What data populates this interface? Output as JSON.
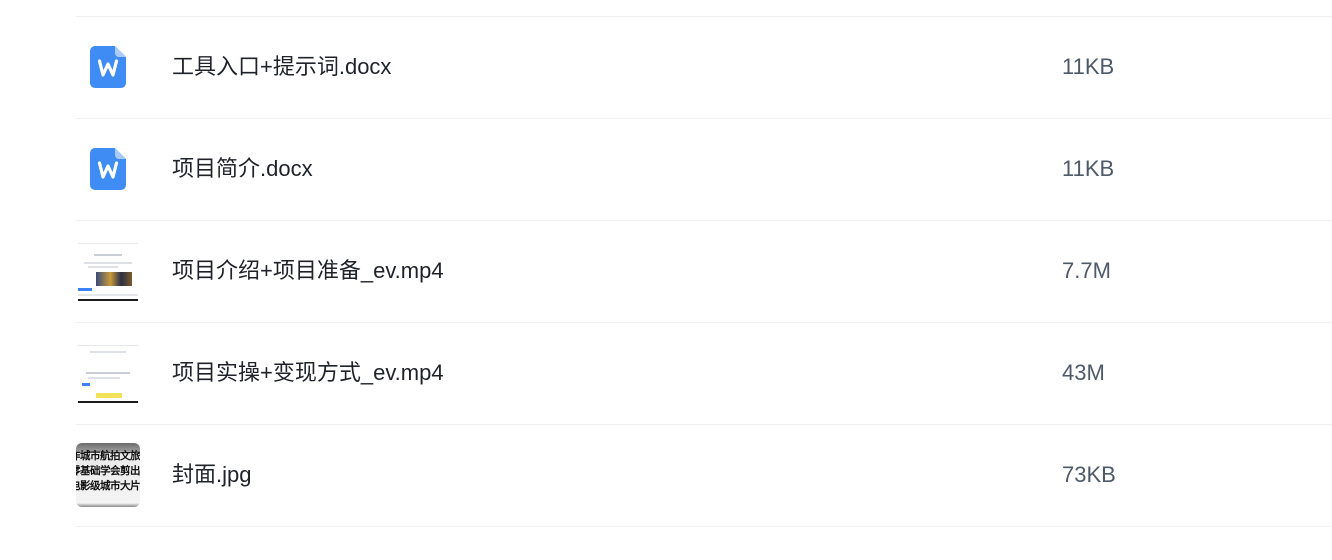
{
  "files": [
    {
      "name": "工具入口+提示词.docx",
      "size": "11KB",
      "icon": "word-document-icon",
      "icon_color": "#3e8cf4"
    },
    {
      "name": "项目简介.docx",
      "size": "11KB",
      "icon": "word-document-icon",
      "icon_color": "#3e8cf4"
    },
    {
      "name": "项目介绍+项目准备_ev.mp4",
      "size": "7.7M",
      "icon": "video-thumbnail"
    },
    {
      "name": "项目实操+变现方式_ev.mp4",
      "size": "43M",
      "icon": "video-thumbnail"
    },
    {
      "name": "封面.jpg",
      "size": "73KB",
      "icon": "image-thumbnail",
      "thumbnail_text": [
        "作城市航拍文旅",
        "零基础学会剪出",
        "电影级城市大片"
      ]
    }
  ]
}
